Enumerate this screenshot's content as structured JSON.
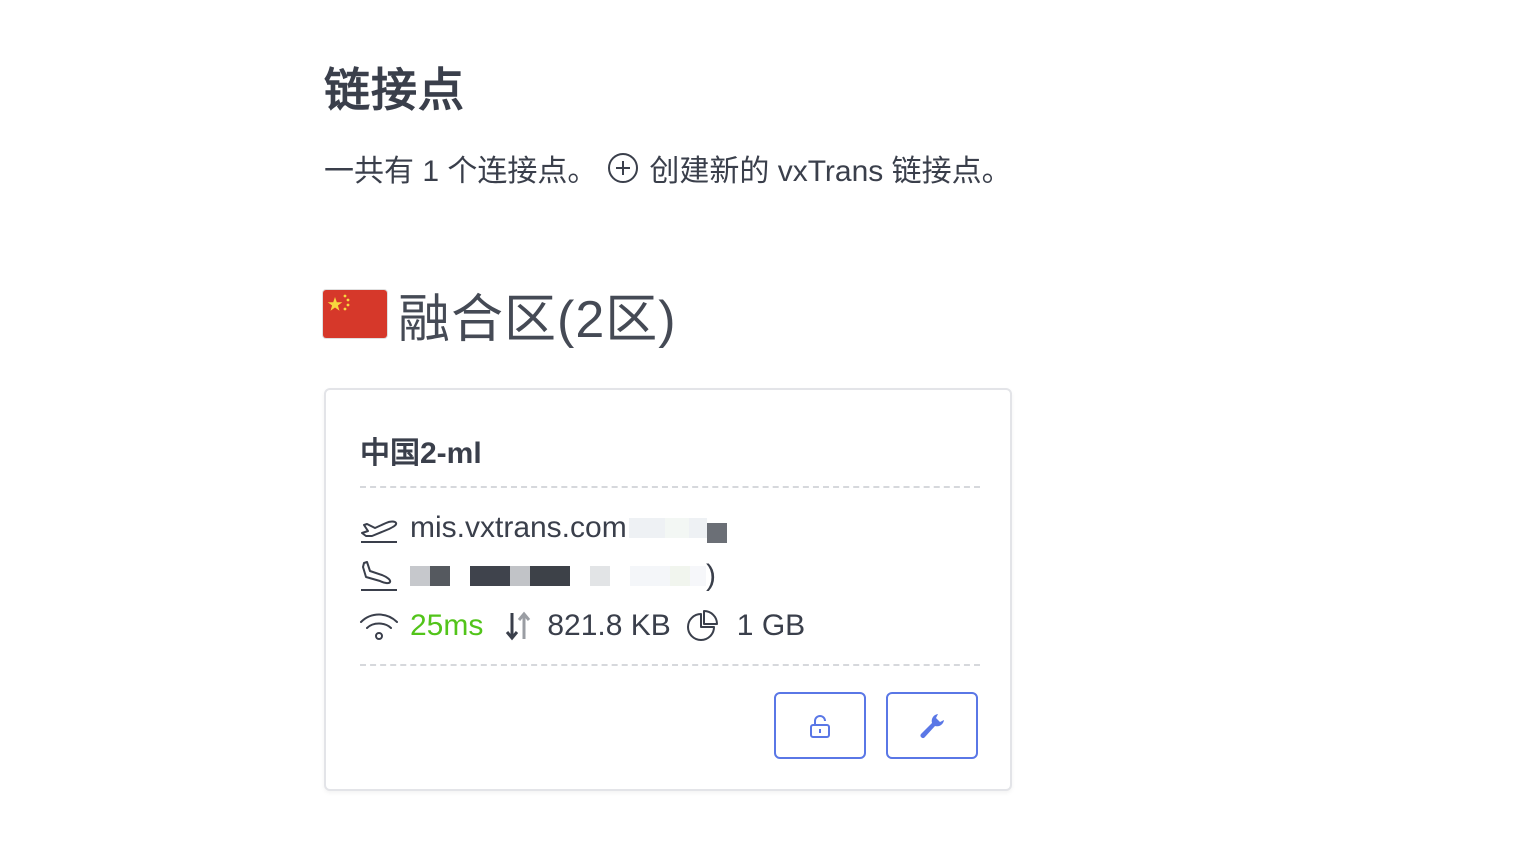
{
  "header": {
    "title": "链接点"
  },
  "summary": {
    "count_text": "一共有 1 个连接点。",
    "create_link_text": "创建新的 vxTrans 链接点。"
  },
  "zone": {
    "flag_icon": "china-flag-icon",
    "title": "融合区(2区)"
  },
  "node": {
    "name": "中国2-ml",
    "departure_host": "mis.vxtrans.com",
    "arrival_text": ")",
    "latency": "25ms",
    "traffic": "821.8 KB",
    "quota": "1 GB",
    "colors": {
      "latency": "#52c41a",
      "button_border": "#5a77e6",
      "text": "#3a3f4b"
    }
  },
  "actions": {
    "lock_icon": "unlock-icon",
    "settings_icon": "wrench-icon"
  }
}
